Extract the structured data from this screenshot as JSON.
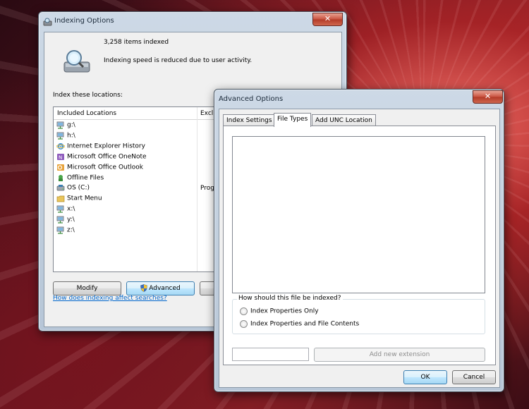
{
  "indexing_window": {
    "title": "Indexing Options",
    "close_glyph": "✕",
    "items_indexed": "3,258 items indexed",
    "speed_status": "Indexing speed is reduced due to user activity.",
    "index_locations_label": "Index these locations:",
    "columns": {
      "included": "Included Locations",
      "excluded": "Exclu"
    },
    "locations": [
      {
        "label": "g:\\",
        "icon": "network-drive-icon"
      },
      {
        "label": "h:\\",
        "icon": "network-drive-icon"
      },
      {
        "label": "Internet Explorer History",
        "icon": "internet-explorer-icon"
      },
      {
        "label": "Microsoft Office OneNote",
        "icon": "onenote-icon"
      },
      {
        "label": "Microsoft Office Outlook",
        "icon": "outlook-icon"
      },
      {
        "label": "Offline Files",
        "icon": "offline-files-icon"
      },
      {
        "label": "OS (C:)",
        "icon": "drive-icon",
        "excluded": "Progr"
      },
      {
        "label": "Start Menu",
        "icon": "folder-icon"
      },
      {
        "label": "x:\\",
        "icon": "network-drive-icon"
      },
      {
        "label": "y:\\",
        "icon": "network-drive-icon"
      },
      {
        "label": "z:\\",
        "icon": "network-drive-icon"
      }
    ],
    "buttons": {
      "modify": "Modify",
      "advanced": "Advanced"
    },
    "help_link": "How does indexing affect searches?"
  },
  "advanced_window": {
    "title": "Advanced Options",
    "close_glyph": "✕",
    "tabs": [
      {
        "label": "Index Settings",
        "active": false
      },
      {
        "label": "File Types",
        "active": true
      },
      {
        "label": "Add UNC Location",
        "active": false
      }
    ],
    "index_group_title": "How should this file be indexed?",
    "options": [
      {
        "label": "Index Properties Only",
        "selected": false
      },
      {
        "label": "Index Properties and File Contents",
        "selected": false
      }
    ],
    "extension_input_value": "",
    "add_extension_button": "Add new extension",
    "ok_button": "OK",
    "cancel_button": "Cancel"
  },
  "colors": {
    "link": "#0066cc",
    "accent_border": "#3c7fb1",
    "close_red": "#c9523f"
  }
}
